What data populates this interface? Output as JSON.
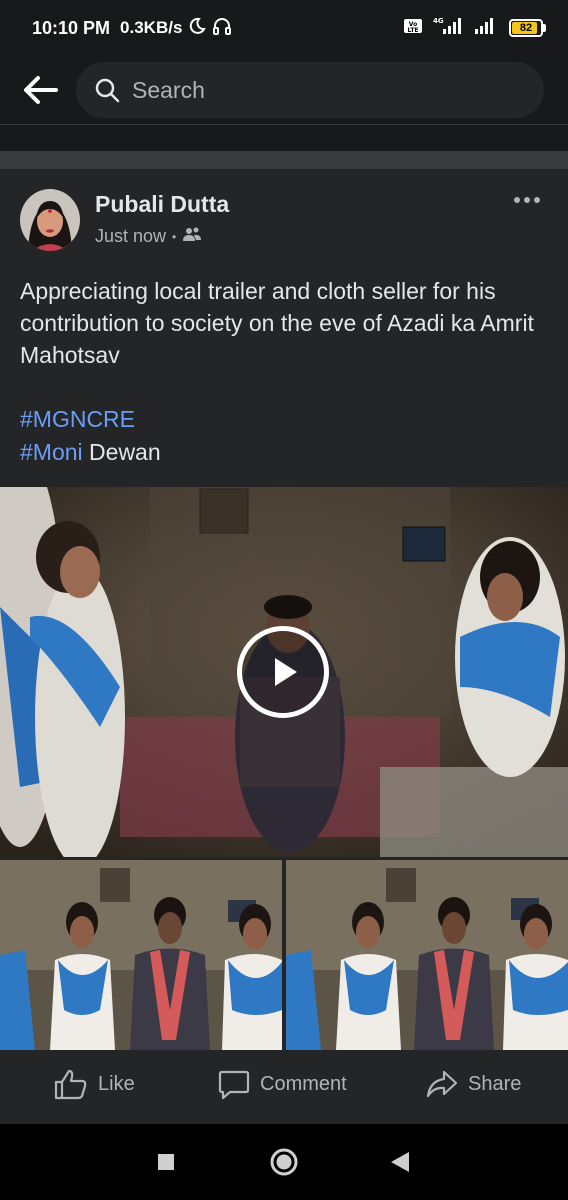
{
  "status_bar": {
    "time": "10:10 PM",
    "net_speed": "0.3KB/s",
    "battery_level": "82",
    "network_type": "4G",
    "volte": "Vo LTE"
  },
  "top_bar": {
    "search_placeholder": "Search"
  },
  "post": {
    "author": "Pubali Dutta",
    "timestamp": "Just now",
    "separator": "•",
    "audience_icon": "friends-icon",
    "text": "Appreciating local trailer and cloth seller for his contribution to society on the eve of Azadi ka Amrit Mahotsav",
    "tags": [
      {
        "hash": "#MGNCRE",
        "rest": ""
      },
      {
        "hash": "#Moni",
        "rest": " Dewan"
      }
    ]
  },
  "actions": {
    "like": "Like",
    "comment": "Comment",
    "share": "Share"
  },
  "colors": {
    "background": "#18191a",
    "card": "#242526",
    "link": "#6b9df7",
    "secondary_text": "#b0b3b8"
  }
}
